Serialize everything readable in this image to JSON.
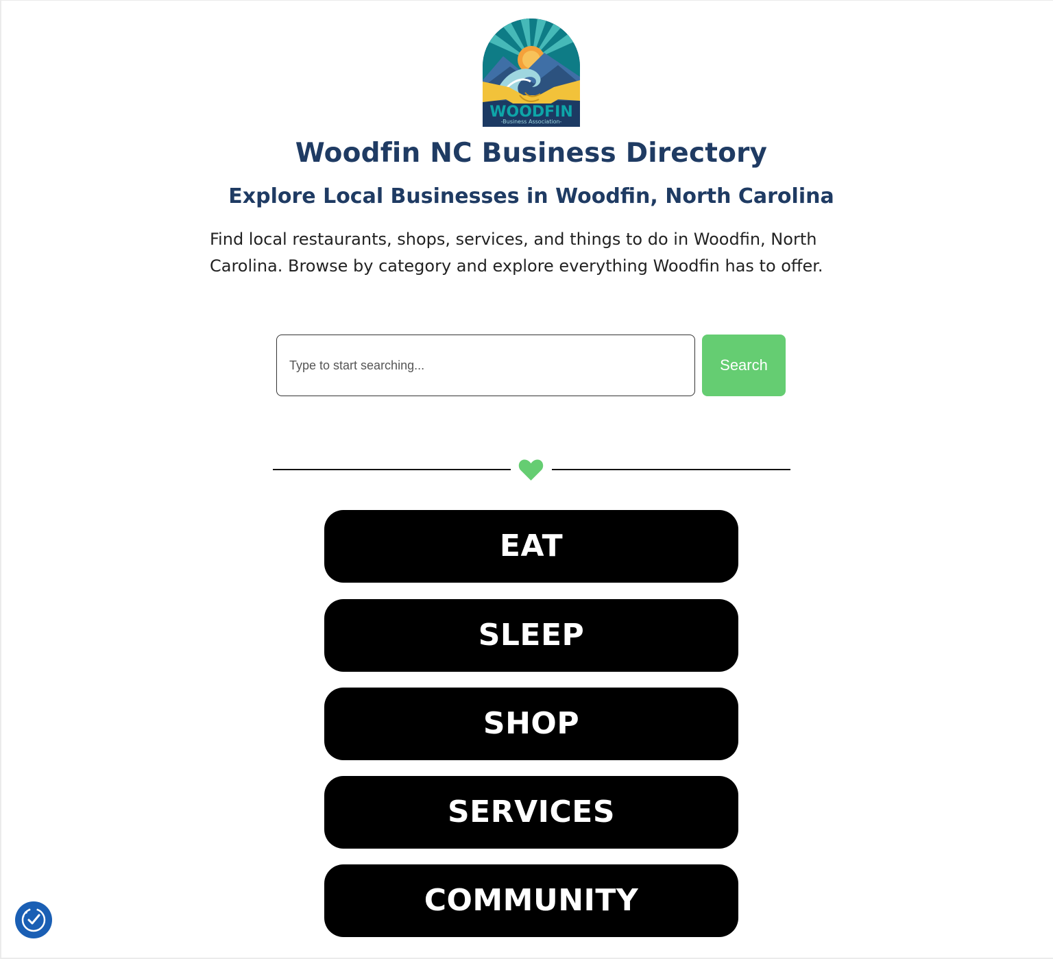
{
  "logo": {
    "text": "WOODFIN",
    "tagline": "-Business Association-",
    "colors": {
      "teal": "#0e7c86",
      "navy": "#1c3a63",
      "sun": "#f4a13a",
      "gold": "#f2c23a",
      "wave": "#9fd6df"
    }
  },
  "header": {
    "title": "Woodfin NC Business Directory",
    "subtitle": "Explore Local Businesses in Woodfin, North Carolina",
    "intro": "Find local restaurants, shops, services, and things to do in Woodfin, North Carolina. Browse by category and explore everything Woodfin has to offer."
  },
  "search": {
    "placeholder": "Type to start searching...",
    "value": "",
    "button_label": "Search"
  },
  "divider": {
    "icon": "heart-icon",
    "color": "#65cd72"
  },
  "categories": [
    {
      "label": "EAT"
    },
    {
      "label": "SLEEP"
    },
    {
      "label": "SHOP"
    },
    {
      "label": "SERVICES"
    },
    {
      "label": "COMMUNITY"
    }
  ],
  "accessibility_widget": {
    "icon": "accessibility-check-icon",
    "color": "#1a5fb4"
  },
  "colors": {
    "heading": "#1f3b63",
    "accent": "#65cd72",
    "category_bg": "#000000",
    "category_text": "#ffffff"
  }
}
